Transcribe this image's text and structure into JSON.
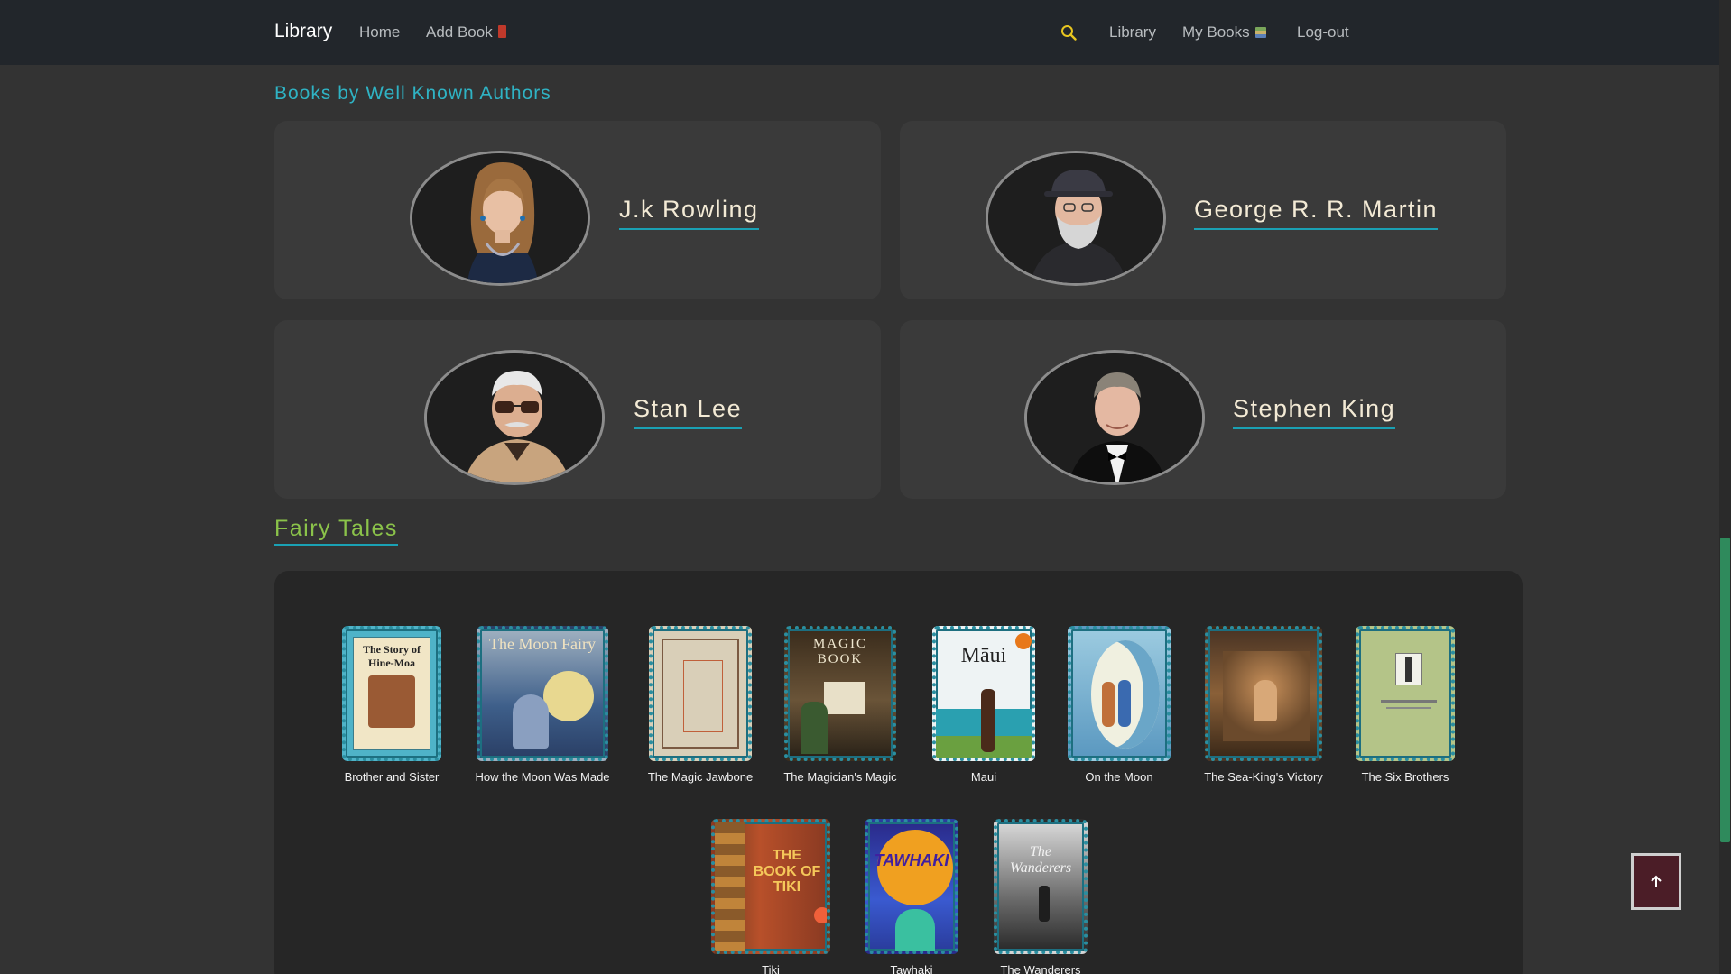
{
  "nav": {
    "brand": "Library",
    "home": "Home",
    "add_book": "Add Book",
    "library": "Library",
    "my_books": "My Books",
    "logout": "Log-out"
  },
  "authors_section": {
    "title": "Books by Well Known Authors",
    "authors": [
      {
        "name": "J.k Rowling"
      },
      {
        "name": "George R. R. Martin"
      },
      {
        "name": "Stan Lee"
      },
      {
        "name": "Stephen King"
      }
    ]
  },
  "fairy_section": {
    "title": "Fairy Tales",
    "books": [
      {
        "title": "Brother and Sister",
        "cover_text": "The Story of Hine-Moa",
        "cover_color": "#4fb3c8"
      },
      {
        "title": "How the Moon Was Made",
        "cover_text": "The Moon Fairy",
        "cover_color": "#3e5f8a"
      },
      {
        "title": "The Magic Jawbone",
        "cover_text": "",
        "cover_color": "#d9cfb8"
      },
      {
        "title": "The Magician's Magic",
        "cover_text": "MAGIC BOOK",
        "cover_color": "#5a4630"
      },
      {
        "title": "Maui",
        "cover_text": "Māui",
        "cover_color": "#e8eef0"
      },
      {
        "title": "On the Moon",
        "cover_text": "",
        "cover_color": "#6aa6c8"
      },
      {
        "title": "The Sea-King's Victory",
        "cover_text": "",
        "cover_color": "#6b4a2c"
      },
      {
        "title": "The Six Brothers",
        "cover_text": "",
        "cover_color": "#a8b87a"
      },
      {
        "title": "Tiki",
        "cover_text": "THE BOOK OF TIKI",
        "cover_color": "#8a3a22"
      },
      {
        "title": "Tawhaki",
        "cover_text": "TAWHAKI",
        "cover_color": "#2a3c9c"
      },
      {
        "title": "The Wanderers",
        "cover_text": "The Wanderers",
        "cover_color": "#5a5a5a"
      }
    ]
  },
  "colors": {
    "accent_teal": "#2fb3c4",
    "accent_green": "#8bc34a",
    "navbar_bg": "#22262b",
    "search_icon": "#e7c520"
  }
}
